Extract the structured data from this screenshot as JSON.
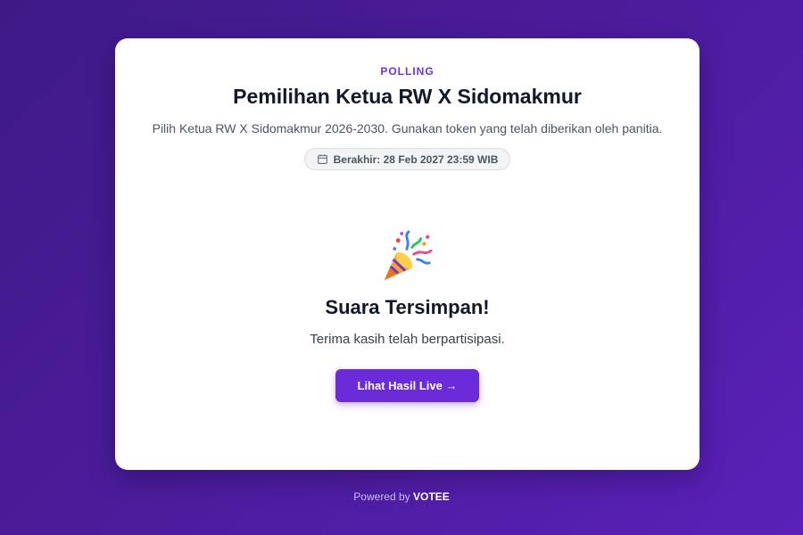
{
  "poll": {
    "eyebrow": "POLLING",
    "title": "Pemilihan Ketua RW X Sidomakmur",
    "description": "Pilih Ketua RW X Sidomakmur 2026-2030. Gunakan token yang telah diberikan oleh panitia.",
    "deadline_icon": "calendar-icon",
    "deadline": "Berakhir: 28 Feb 2027 23:59 WIB"
  },
  "result": {
    "icon": "party-popper-icon",
    "title": "Suara Tersimpan!",
    "message": "Terima kasih telah berpartisipasi.",
    "button_label": "Lihat Hasil Live →"
  },
  "footer": {
    "prefix": "Powered by",
    "brand": "VOTEE"
  },
  "colors": {
    "accent": "#6c2bd9",
    "background_start": "#3f1a86",
    "background_end": "#5a20b8"
  }
}
